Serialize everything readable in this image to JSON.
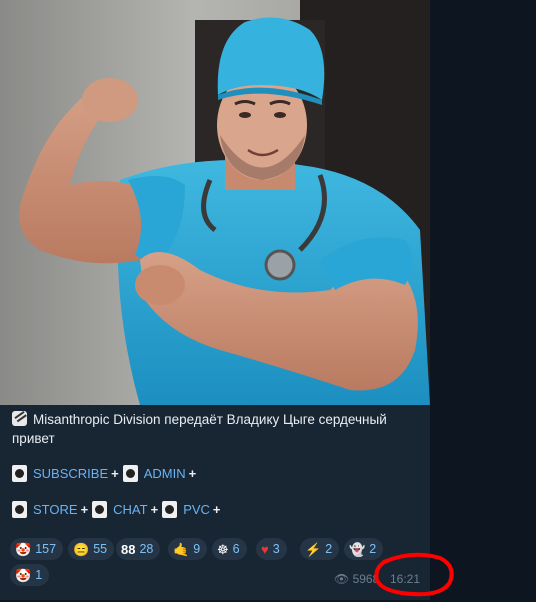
{
  "message": {
    "caption_line1": "Misanthropic Division передаёт Владику Цыге сердечный",
    "caption_line2": "привет",
    "links_row1": [
      {
        "label": "SUBSCRIBE"
      },
      {
        "label": "ADMIN"
      }
    ],
    "links_row2": [
      {
        "label": "STORE"
      },
      {
        "label": "CHAT"
      },
      {
        "label": "PVC"
      }
    ],
    "plus": "+",
    "reactions": [
      {
        "emoji": "🤡",
        "count": "157"
      },
      {
        "emoji": "😑",
        "count": "55"
      },
      {
        "emoji": "88",
        "count": "28"
      },
      {
        "emoji": "🤙",
        "count": "9"
      },
      {
        "emoji": "☸",
        "count": "6"
      },
      {
        "emoji": "♥",
        "count": "3"
      },
      {
        "emoji": "⚡",
        "count": "2"
      },
      {
        "emoji": "👻",
        "count": "2"
      },
      {
        "emoji": "🤡",
        "count": "1"
      }
    ],
    "views": "5968",
    "time": "16:21"
  },
  "colors": {
    "accent": "#6ab3f3",
    "bubble": "#182533",
    "background": "#0e1621",
    "annotation": "#ff0000"
  }
}
